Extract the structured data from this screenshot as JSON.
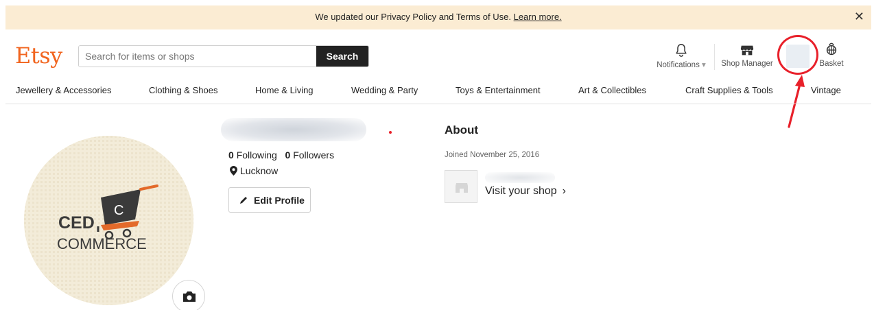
{
  "banner": {
    "text": "We updated our Privacy Policy and Terms of Use.",
    "link": "Learn more.",
    "close_glyph": "✕"
  },
  "header": {
    "logo": "Etsy",
    "search": {
      "placeholder": "Search for items or shops",
      "value": "",
      "button_label": "Search"
    },
    "tools": {
      "notifications": {
        "label": "Notifications",
        "caret": "▾",
        "icon": "bell-icon"
      },
      "shop_manager": {
        "label": "Shop Manager",
        "icon": "shop-icon"
      },
      "basket": {
        "label": "Basket",
        "icon": "basket-icon"
      }
    },
    "annotation_color": "#e8202a"
  },
  "categories": [
    "Jewellery & Accessories",
    "Clothing & Shoes",
    "Home & Living",
    "Wedding & Party",
    "Toys & Entertainment",
    "Art & Collectibles",
    "Craft Supplies & Tools",
    "Vintage"
  ],
  "profile": {
    "logo_text_top": "CED",
    "logo_text_bottom": "COMMERCE",
    "logo_cart_letter": "C",
    "following_count": "0",
    "following_label": "Following",
    "followers_count": "0",
    "followers_label": "Followers",
    "location": "Lucknow",
    "edit_button": "Edit Profile",
    "camera_icon": "camera-icon"
  },
  "about": {
    "title": "About",
    "joined": "Joined November 25, 2016",
    "visit_shop": "Visit your shop",
    "chevron": "›"
  },
  "colors": {
    "brand": "#f1641e",
    "banner_bg": "#fbecd3",
    "search_button_bg": "#222222"
  }
}
